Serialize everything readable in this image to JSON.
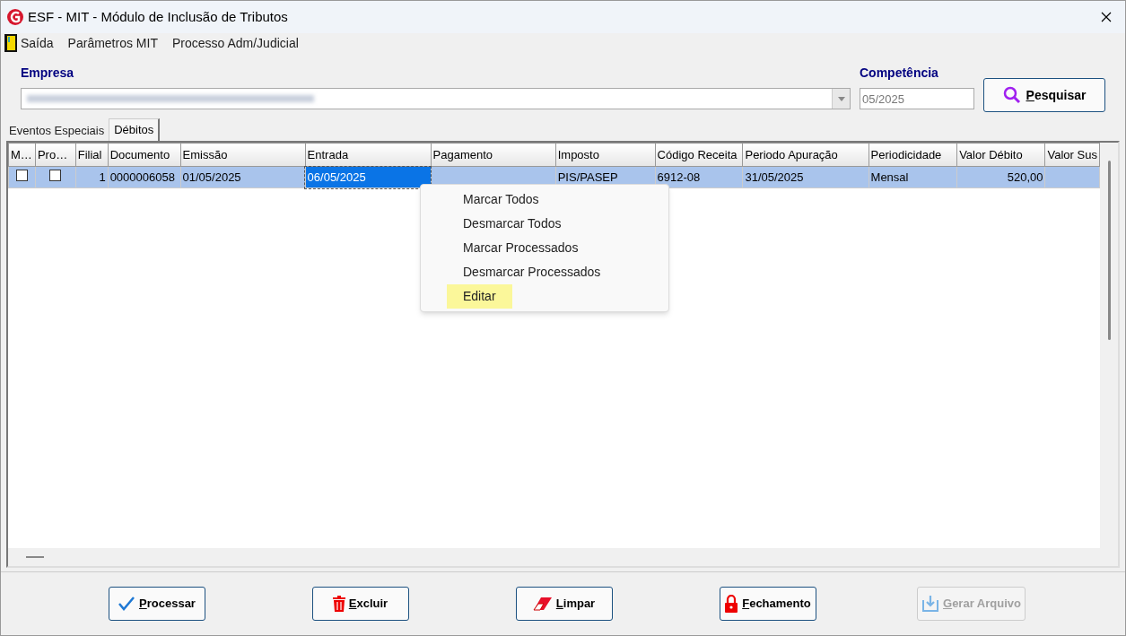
{
  "window": {
    "title": "ESF - MIT - Módulo de Inclusão de Tributos"
  },
  "menu": [
    {
      "label": "Saída",
      "kind": "exit"
    },
    {
      "label": "Parâmetros MIT"
    },
    {
      "label": "Processo Adm/Judicial"
    }
  ],
  "empresa": {
    "label": "Empresa"
  },
  "competencia": {
    "label": "Competência",
    "value": "05/2025"
  },
  "search_button": {
    "label": "Pesquisar"
  },
  "tabs": [
    {
      "label": "Eventos Especiais",
      "selected": false
    },
    {
      "label": "Débitos",
      "selected": true
    }
  ],
  "table": {
    "columns": [
      "M…",
      "Pro…",
      "Filial",
      "Documento",
      "Emissão",
      "Entrada",
      "Pagamento",
      "Imposto",
      "Código Receita",
      "Periodo Apuração",
      "Periodicidade",
      "Valor Débito",
      "Valor Sus"
    ],
    "rows": [
      {
        "selected": true,
        "cells": [
          {
            "kind": "checkbox",
            "checked": false
          },
          {
            "kind": "checkbox",
            "checked": false
          },
          {
            "kind": "number",
            "text": "1"
          },
          {
            "kind": "text",
            "text": "0000006058"
          },
          {
            "kind": "text",
            "text": "01/05/2025"
          },
          {
            "kind": "text",
            "text": "06/05/2025",
            "focused": true
          },
          {
            "kind": "text"
          },
          {
            "kind": "text",
            "text": "PIS/PASEP"
          },
          {
            "kind": "text",
            "text": "6912-08"
          },
          {
            "kind": "text",
            "text": "31/05/2025"
          },
          {
            "kind": "text",
            "text": "Mensal"
          },
          {
            "kind": "number",
            "text": "520,00"
          },
          {
            "kind": "text"
          }
        ]
      }
    ]
  },
  "context_menu": [
    {
      "label": "Marcar Todos",
      "selected": false
    },
    {
      "label": "Desmarcar Todos",
      "selected": false
    },
    {
      "label": "Marcar Processados",
      "selected": false
    },
    {
      "label": "Desmarcar Processados",
      "selected": false
    },
    {
      "label": "Editar",
      "selected": true
    }
  ],
  "buttons": [
    {
      "label": "Processar",
      "kind": "check",
      "disabled": false
    },
    {
      "label": "Excluir",
      "kind": "trash",
      "disabled": false
    },
    {
      "label": "Limpar",
      "kind": "eraser",
      "disabled": false
    },
    {
      "label": "Fechamento",
      "kind": "lock",
      "disabled": false
    },
    {
      "label": "Gerar Arquivo",
      "kind": "download",
      "disabled": true
    }
  ]
}
